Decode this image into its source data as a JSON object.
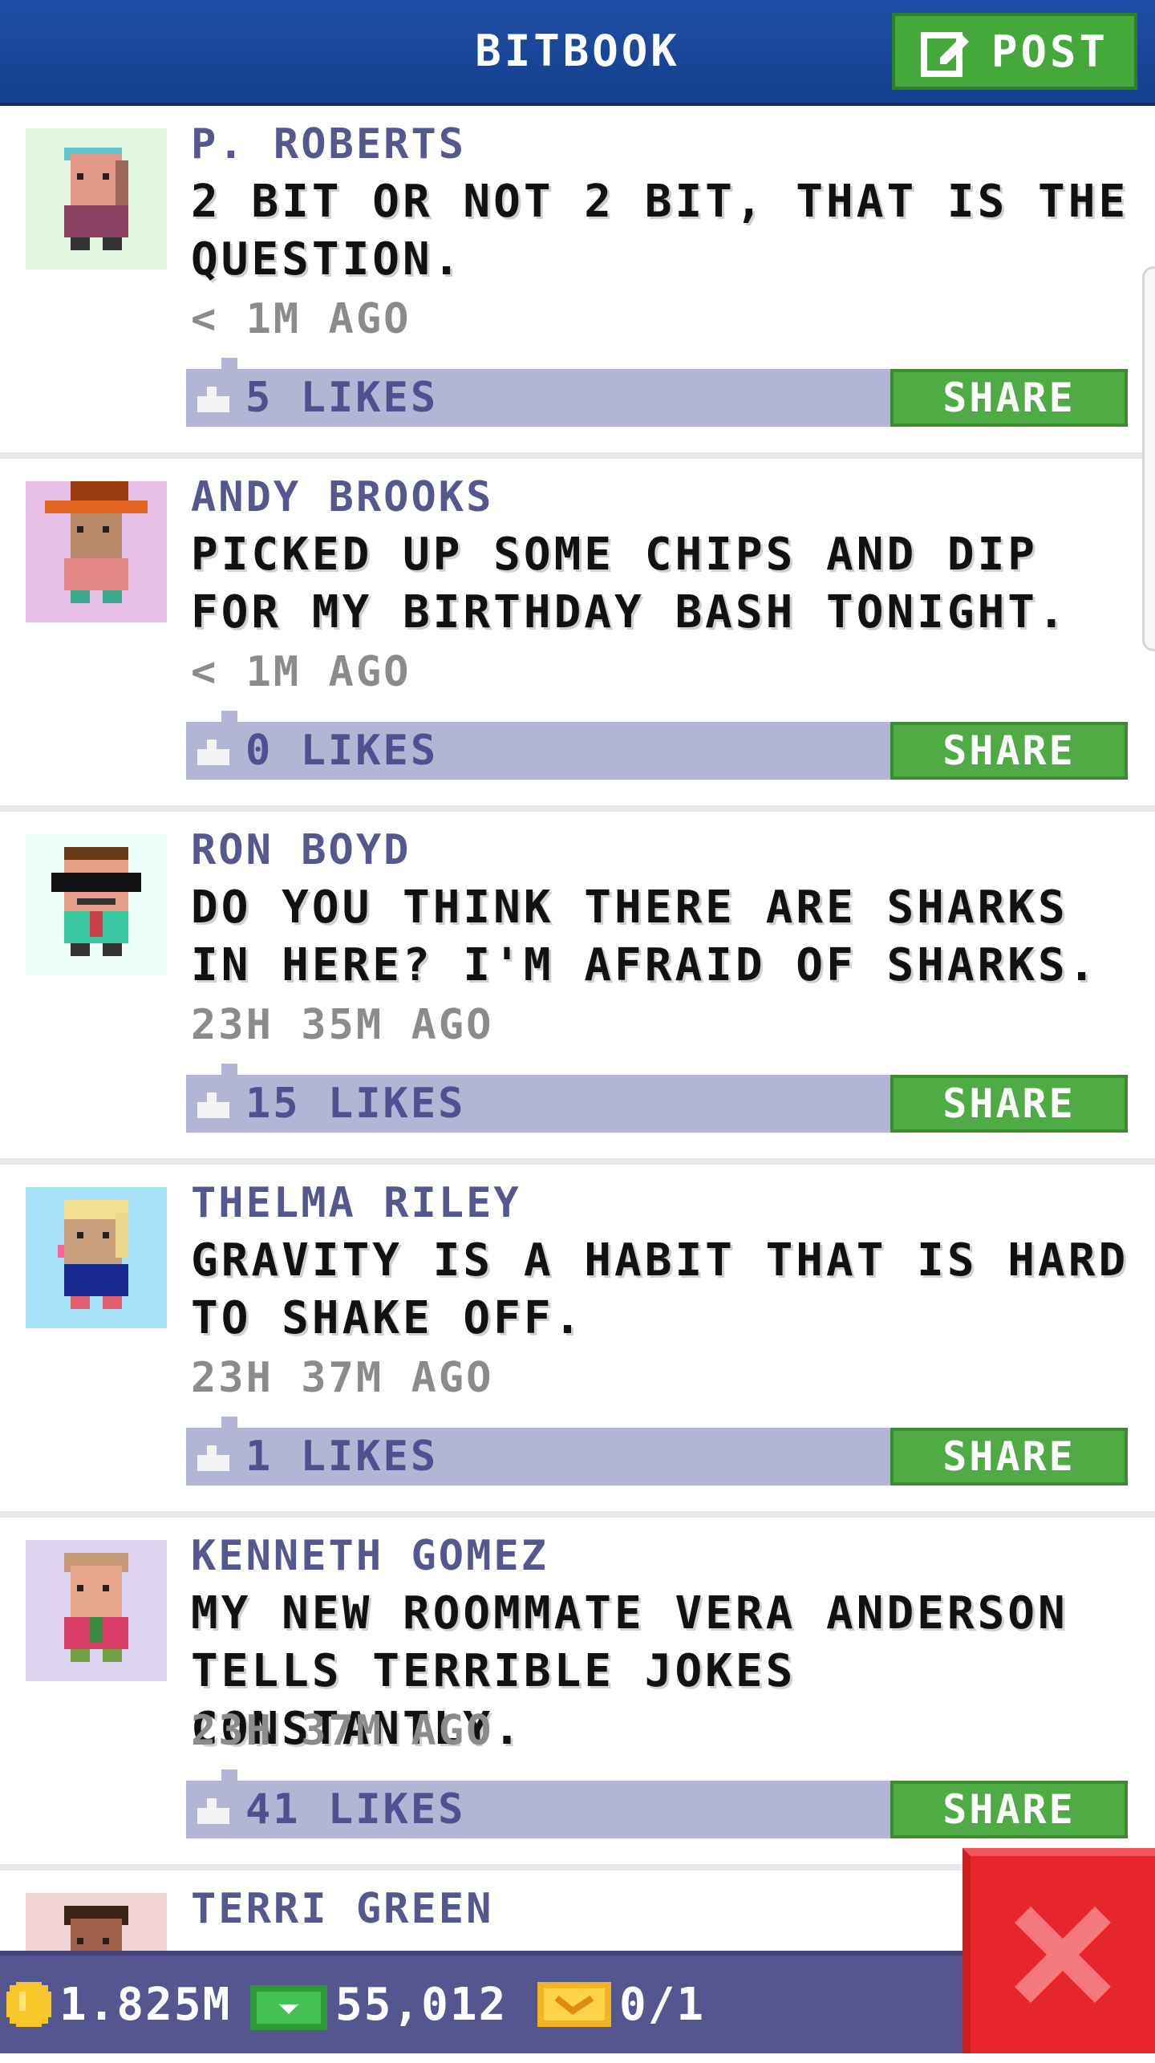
{
  "header": {
    "title": "BITBOOK",
    "post_label": "POST",
    "colors": {
      "background": "#1a4a9e",
      "post_button": "#44a83a"
    }
  },
  "posts": [
    {
      "author": "P. ROBERTS",
      "message": "2 BIT OR NOT 2 BIT, THAT IS THE QUESTION.",
      "time": "< 1M AGO",
      "likes": "5 LIKES",
      "share_label": "SHARE",
      "avatar_bg": "#e3f7e3"
    },
    {
      "author": "ANDY BROOKS",
      "message": "PICKED UP SOME CHIPS AND DIP FOR MY BIRTHDAY BASH TONIGHT.",
      "time": "< 1M AGO",
      "likes": "0 LIKES",
      "share_label": "SHARE",
      "avatar_bg": "#e6c0e8"
    },
    {
      "author": "RON BOYD",
      "message": "DO YOU THINK THERE ARE SHARKS IN HERE? I'M AFRAID OF SHARKS.",
      "time": "23H 35M AGO",
      "likes": "15 LIKES",
      "share_label": "SHARE",
      "avatar_bg": "#eefcf7"
    },
    {
      "author": "THELMA RILEY",
      "message": "GRAVITY IS A HABIT THAT IS HARD TO SHAKE OFF.",
      "time": "23H 37M AGO",
      "likes": "1 LIKES",
      "share_label": "SHARE",
      "avatar_bg": "#a6e1f7"
    },
    {
      "author": "KENNETH GOMEZ",
      "message": "MY NEW ROOMMATE VERA ANDERSON TELLS TERRIBLE JOKES CONSTANTLY.",
      "time": "23H 37M AGO",
      "likes": "41 LIKES",
      "share_label": "SHARE",
      "avatar_bg": "#ddd5ef"
    },
    {
      "author": "TERRI GREEN",
      "avatar_bg": "#f2d3d3"
    }
  ],
  "bottom_bar": {
    "coins": "1.825M",
    "bux": "55,012",
    "tickets": "0/1"
  },
  "icons": {
    "post": "edit-icon",
    "like": "thumbs-up-icon",
    "coins": "coin-icon",
    "bux": "cash-icon",
    "tickets": "ticket-icon",
    "close": "close-icon"
  }
}
